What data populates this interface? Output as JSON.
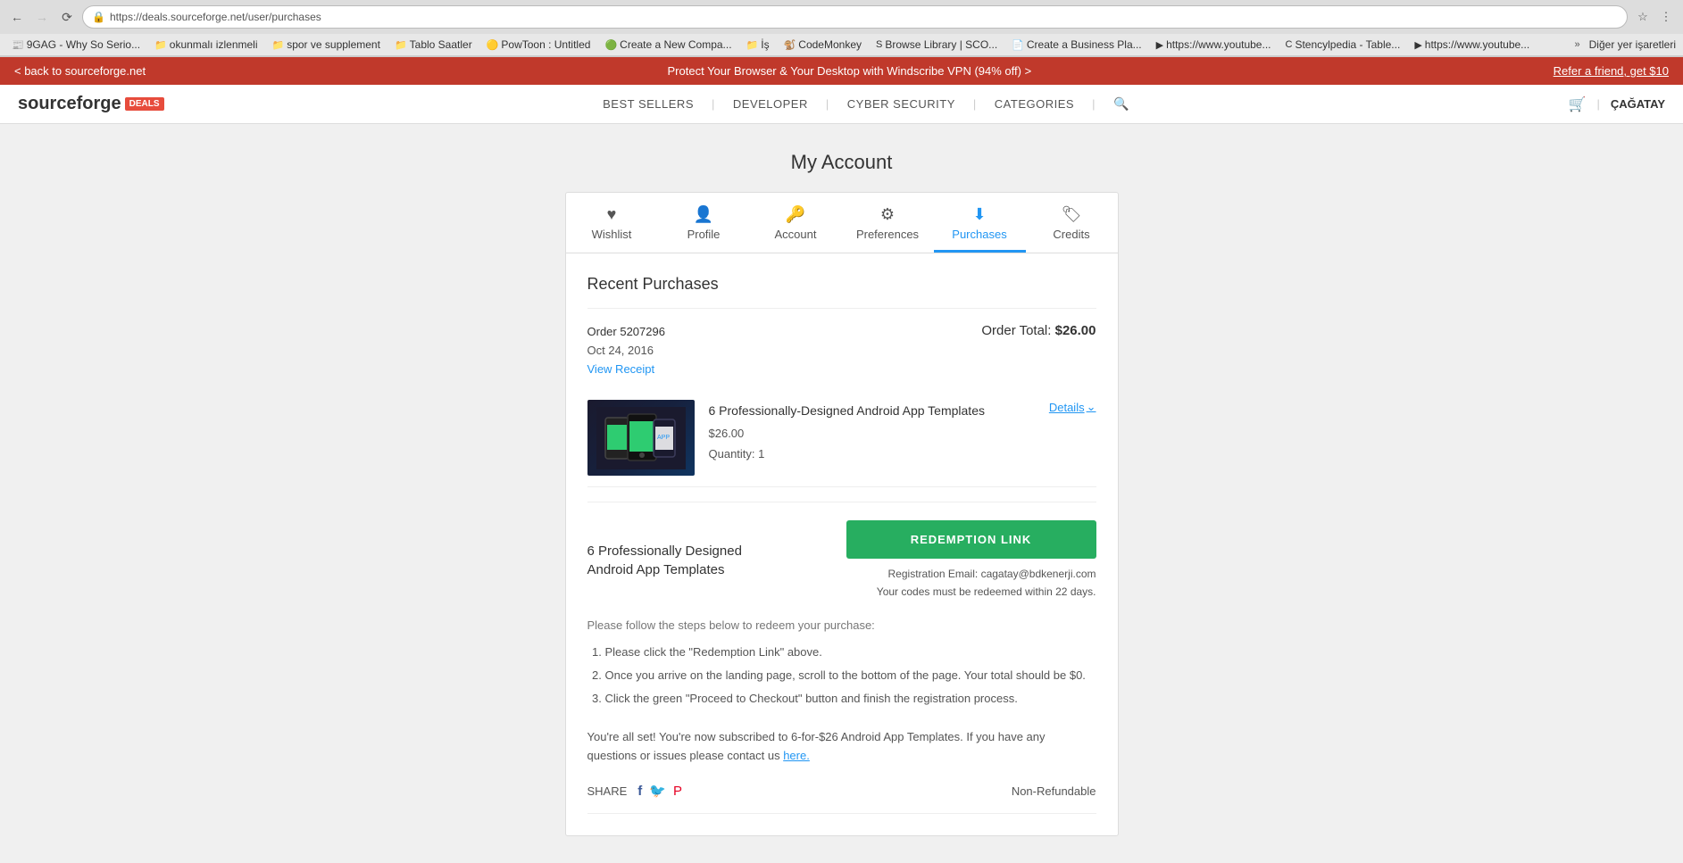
{
  "browser": {
    "url": "https://deals.sourceforge.net/user/purchases",
    "back_disabled": false,
    "forward_disabled": true
  },
  "bookmarks": [
    {
      "label": "9GAG - Why So Serio...",
      "icon": "📰"
    },
    {
      "label": "okunmalı izlenmeli",
      "icon": "📁"
    },
    {
      "label": "spor ve supplement",
      "icon": "📁"
    },
    {
      "label": "Tablo Saatler",
      "icon": "📁"
    },
    {
      "label": "PowToon : Untitled",
      "icon": "🟡"
    },
    {
      "label": "Create a New Compa...",
      "icon": "🟢"
    },
    {
      "label": "İş",
      "icon": "📁"
    },
    {
      "label": "CodeMonkey",
      "icon": "🐒"
    },
    {
      "label": "Browse Library | SCO...",
      "icon": "S"
    },
    {
      "label": "Create a Business Pla...",
      "icon": "📄"
    },
    {
      "label": "https://www.youtube...",
      "icon": "▶"
    },
    {
      "label": "Stencylpedia - Table...",
      "icon": "C"
    },
    {
      "label": "https://www.youtube...",
      "icon": "▶"
    }
  ],
  "bookmarks_folder": "Diğer yer işaretleri",
  "announcement": {
    "back_link": "< back to sourceforge.net",
    "promo_text": "Protect Your Browser & Your Desktop with Windscribe VPN (94% off) >",
    "right_text": "Refer a friend, get $10"
  },
  "header": {
    "logo_text": "sourceforge",
    "logo_badge": "DEALS",
    "nav_items": [
      "BEST SELLERS",
      "DEVELOPER",
      "CYBER SECURITY",
      "CATEGORIES"
    ],
    "username": "ÇAĞATAY"
  },
  "page": {
    "title": "My Account"
  },
  "tabs": [
    {
      "id": "wishlist",
      "label": "Wishlist",
      "icon": "♥",
      "active": false
    },
    {
      "id": "profile",
      "label": "Profile",
      "icon": "👤",
      "active": false
    },
    {
      "id": "account",
      "label": "Account",
      "icon": "🔑",
      "active": false
    },
    {
      "id": "preferences",
      "label": "Preferences",
      "icon": "⚙",
      "active": false
    },
    {
      "id": "purchases",
      "label": "Purchases",
      "icon": "⬇",
      "active": true
    },
    {
      "id": "credits",
      "label": "Credits",
      "icon": "🏷",
      "active": false
    }
  ],
  "purchases": {
    "section_title": "Recent Purchases",
    "order": {
      "id": "Order 5207296",
      "date": "Oct 24, 2016",
      "view_receipt": "View Receipt",
      "total_label": "Order Total:",
      "total": "$26.00"
    },
    "item": {
      "name": "6 Professionally-Designed Android App Templates",
      "price": "$26.00",
      "quantity_label": "Quantity:",
      "quantity": "1",
      "details_label": "Details"
    },
    "redemption": {
      "product_name": "6 Professionally Designed Android App Templates",
      "button_label": "REDEMPTION LINK",
      "reg_email_label": "Registration Email:",
      "reg_email": "cagatay@bdkenerji.com",
      "codes_note": "Your codes must be redeemed within 22 days.",
      "steps_intro": "Please follow the steps below to redeem your purchase:",
      "steps": [
        "Please click the \"Redemption Link\" above.",
        "Once you arrive on the landing page, scroll to the bottom of the page. Your total should be $0.",
        "Click the green \"Proceed to Checkout\" button and finish the registration process."
      ],
      "footer_note_before": "You're all set! You're now subscribed to 6-for-$26 Android App Templates. If you have any questions or issues please contact us",
      "footer_link_text": "here.",
      "share_label": "SHARE",
      "non_refundable": "Non-Refundable"
    }
  }
}
